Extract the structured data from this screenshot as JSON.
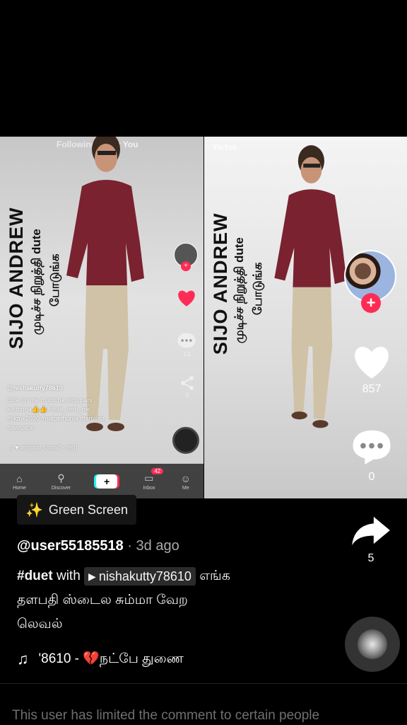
{
  "left_video": {
    "tabs": {
      "following": "Following",
      "for_you": "For You"
    },
    "vertical_title": "SIJO ANDREW",
    "vertical_sub1": "முடிச்ச நிறுத்தி dute",
    "vertical_sub2": "போடுங்க",
    "username": "@nishakutty78610",
    "caption_lines": [
      "dute un me mudicha stop pani",
      "kattunga👍👍#dute_with_me",
      "#tiktok2020 #natpethunai #tamilan",
      "#awsome"
    ],
    "sound": "original sound - nish",
    "comment_count": "13",
    "share_count": "0",
    "inbox_badge": "42",
    "tab_labels": [
      "Home",
      "Discover",
      "",
      "Inbox",
      "Me"
    ]
  },
  "right_video": {
    "watermark": "TikTok",
    "vertical_title": "SIJO ANDREW",
    "vertical_sub1": "முடிச்ச நிறுத்தி dute",
    "vertical_sub2": "போடுங்க",
    "like_count": "857",
    "comment_count": "0"
  },
  "effect": {
    "label": "Green Screen"
  },
  "post": {
    "username": "@user55185518",
    "separator": " · ",
    "time_ago": "3d ago",
    "caption_hashtag": "#duet",
    "caption_with": "with",
    "duet_user": "nishakutty78610",
    "caption_rest_1": "எங்க",
    "caption_line2": "தளபதி ஸ்டைல சும்மா வேற",
    "caption_line3": "லெவல்"
  },
  "music": {
    "text": "'8610 - 💔நட்பே துணை"
  },
  "share": {
    "count": "5"
  },
  "comment_notice": "This user has limited the comment to certain people",
  "colors": {
    "accent_red": "#fe2c55",
    "cyan": "#25f4ee",
    "shirt": "#7a2230"
  },
  "icons": [
    "home-icon",
    "discover-icon",
    "plus-icon",
    "inbox-icon",
    "me-icon",
    "heart-icon",
    "comment-icon",
    "share-icon",
    "music-note-icon",
    "sparkle-icon",
    "play-icon",
    "disc-icon"
  ]
}
